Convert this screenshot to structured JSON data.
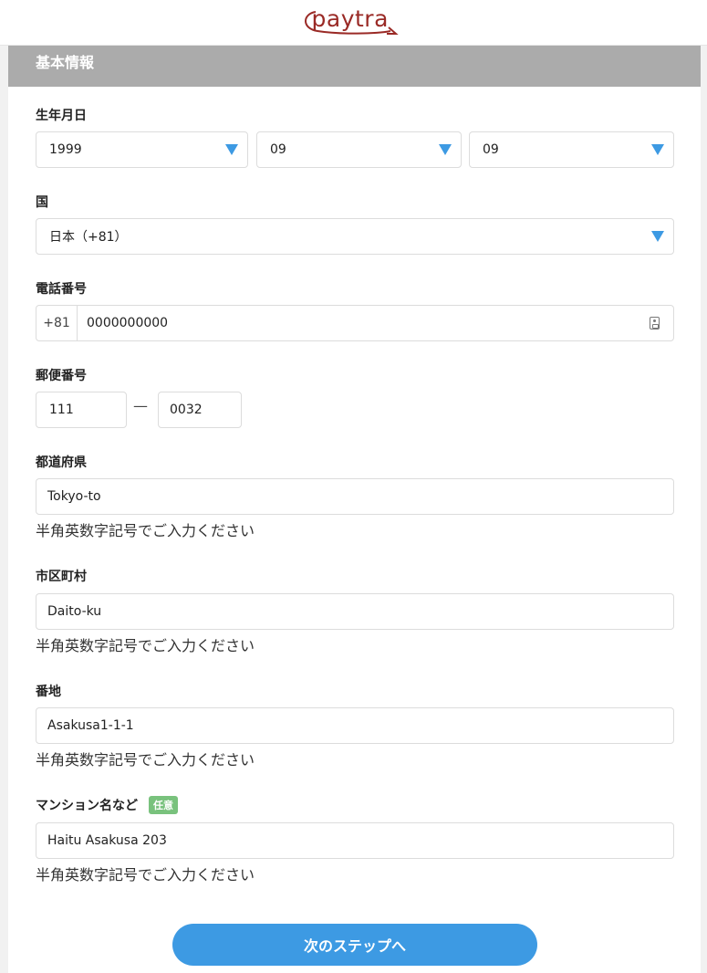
{
  "header": {
    "logo_text": "paytra"
  },
  "section": {
    "title": "基本情報"
  },
  "birthdate": {
    "label": "生年月日",
    "year": "1999",
    "month": "09",
    "day": "09"
  },
  "country": {
    "label": "国",
    "value": "日本（+81）"
  },
  "phone": {
    "label": "電話番号",
    "prefix": "+81",
    "value": "0000000000"
  },
  "postal": {
    "label": "郵便番号",
    "part1": "111",
    "separator": "—",
    "part2": "0032"
  },
  "prefecture": {
    "label": "都道府県",
    "value": "Tokyo-to",
    "hint": "半角英数字記号でご入力ください"
  },
  "city": {
    "label": "市区町村",
    "value": "Daito-ku",
    "hint": "半角英数字記号でご入力ください"
  },
  "address": {
    "label": "番地",
    "value": "Asakusa1-1-1",
    "hint": "半角英数字記号でご入力ください"
  },
  "building": {
    "label": "マンション名など",
    "optional_badge": "任意",
    "value": "Haitu Asakusa 203",
    "hint": "半角英数字記号でご入力ください"
  },
  "actions": {
    "next_label": "次のステップへ"
  },
  "colors": {
    "accent": "#3d9ae3",
    "logo": "#9a2a26",
    "section_bar": "#ababab",
    "badge": "#79c27d"
  }
}
